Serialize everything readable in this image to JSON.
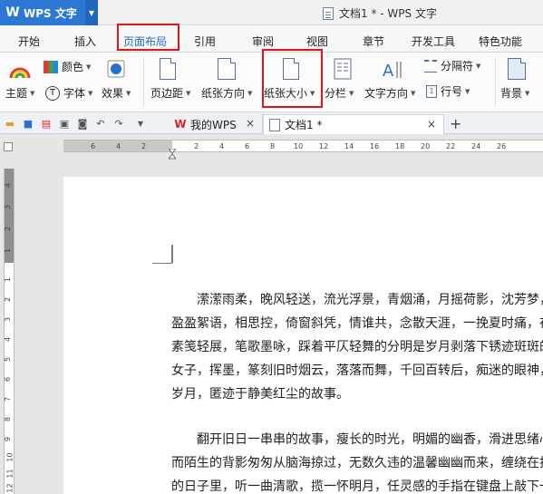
{
  "app": {
    "name": "WPS 文字",
    "logo": "W"
  },
  "window_title": "文档1 * - WPS 文字",
  "menu_tabs": [
    "开始",
    "插入",
    "页面布局",
    "引用",
    "审阅",
    "视图",
    "章节",
    "开发工具",
    "特色功能"
  ],
  "active_tab": "页面布局",
  "ribbon": {
    "color": "颜色",
    "theme": "主题",
    "font": "字体",
    "effect": "效果",
    "margins": "页边距",
    "orientation": "纸张方向",
    "size": "纸张大小",
    "columns": "分栏",
    "text_direction": "文字方向",
    "separator": "分隔符",
    "line_number": "行号",
    "background": "背景"
  },
  "doc_tabs": [
    {
      "label": "我的WPS",
      "active": false
    },
    {
      "label": "文档1 *",
      "active": true
    }
  ],
  "ruler_ticks": [
    "6",
    "4",
    "2",
    "2",
    "4",
    "6",
    "8",
    "10",
    "12",
    "14",
    "16",
    "18",
    "20",
    "22",
    "24",
    "26"
  ],
  "vruler_ticks": [
    "4",
    "3",
    "2",
    "1",
    "1",
    "2",
    "3",
    "4",
    "5",
    "6",
    "7",
    "8",
    "9",
    "10",
    "11",
    "12"
  ],
  "document": {
    "para1": [
      "　　潆潆雨柔，晚风轻送，流光浮景，青烟涌，月摇荷影，沈芳梦，",
      "盈盈絮语，相思控，倚窗斜凭，情谁共，念散天涯，一挽夏时痛，在",
      "素笺轻展，笔歌墨咏，踩着平仄轻舞的分明是岁月剥落下锈迹斑斑的",
      "女子，挥墨，篆刻旧时烟云，落落而舞，千回百转后，痴迷的眼神，",
      "岁月，匿迹于静美红尘的故事。"
    ],
    "para2": [
      "　　翻开旧日一串串的故事，瘦长的时光，明媚的幽香，滑进思绪心",
      "而陌生的背影匆匆从脑海掠过，无数久违的温馨幽幽而来，缠绕在指",
      "的日子里，听一曲清歌，揽一怀明月，任灵感的手指在键盘上敲下一"
    ]
  }
}
